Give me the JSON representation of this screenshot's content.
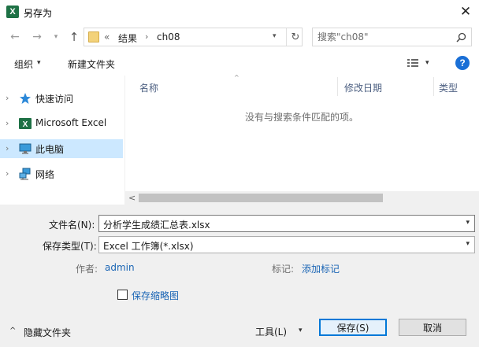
{
  "window": {
    "title": "另存为",
    "app_icon_letter": "X",
    "close_glyph": "✕"
  },
  "nav": {
    "back_glyph": "←",
    "forward_glyph": "→",
    "recent_glyph": "▾",
    "up_glyph": "↑"
  },
  "address": {
    "overflow": "«",
    "crumbs": [
      "结果",
      "ch08"
    ],
    "separator": "›",
    "dropdown_glyph": "▾",
    "refresh_glyph": "↻"
  },
  "search": {
    "placeholder": "搜索\"ch08\"",
    "icon": "search-icon"
  },
  "toolbar": {
    "organize_label": "组织",
    "organize_caret": "▾",
    "new_folder_label": "新建文件夹",
    "view_caret": "▾",
    "help_glyph": "?"
  },
  "sidebar": {
    "items": [
      {
        "label": "快速访问",
        "icon": "star-icon",
        "chevron": "›",
        "selected": false
      },
      {
        "label": "Microsoft Excel",
        "icon": "excel-icon",
        "chevron": "›",
        "selected": false
      },
      {
        "label": "此电脑",
        "icon": "computer-icon",
        "chevron": "›",
        "selected": true
      },
      {
        "label": "网络",
        "icon": "network-icon",
        "chevron": "›",
        "selected": false
      }
    ]
  },
  "file_list": {
    "columns": [
      "名称",
      "修改日期",
      "类型"
    ],
    "sort_glyph": "^",
    "empty_message": "没有与搜索条件匹配的项。"
  },
  "scrollbar": {
    "left_glyph": "<"
  },
  "form": {
    "filename_label": "文件名(N):",
    "filename_value": "分析学生成绩汇总表.xlsx",
    "filetype_label": "保存类型(T):",
    "filetype_value": "Excel 工作簿(*.xlsx)",
    "dropdown_glyph": "▾",
    "author_label": "作者:",
    "author_value": "admin",
    "tags_label": "标记:",
    "tags_value": "添加标记",
    "thumbnail_label": "保存缩略图",
    "thumbnail_checked": false
  },
  "footer": {
    "hide_chevron": "^",
    "hide_folders_label": "隐藏文件夹",
    "tools_label": "工具(L)",
    "tools_caret": "▾",
    "save_label": "保存(S)",
    "cancel_label": "取消"
  },
  "colors": {
    "accent": "#0078d7",
    "selection": "#cce8ff",
    "link": "#1a65b5",
    "excel_green": "#1e7145"
  }
}
